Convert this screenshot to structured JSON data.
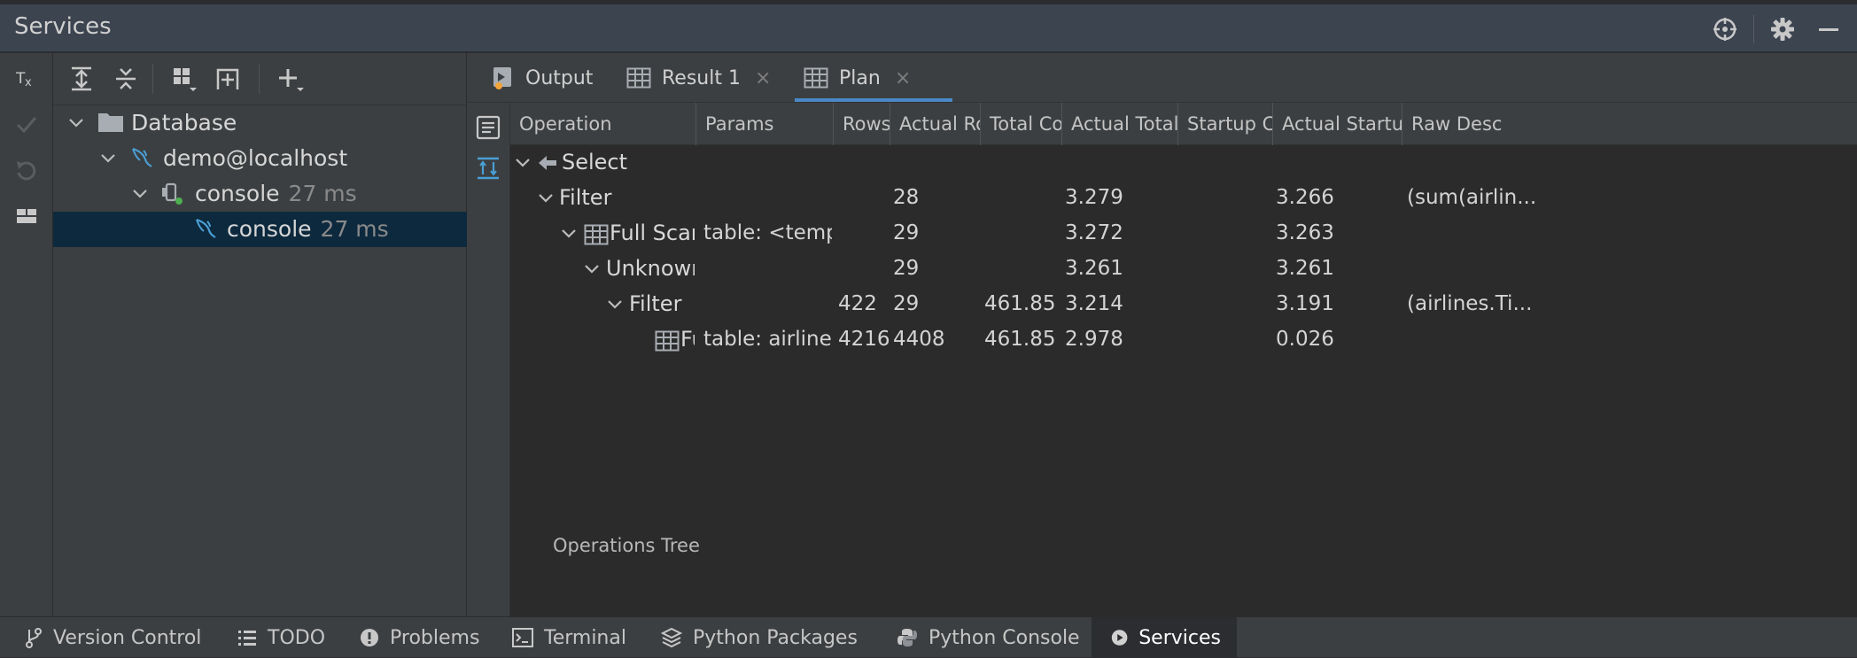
{
  "window": {
    "title": "Services"
  },
  "colors": {
    "accent": "#4a88c7",
    "selection": "#0d293e",
    "mysql_icon": "#4a9fd5",
    "green_dot": "#4caf50",
    "orange_icon": "#f2a33a"
  },
  "left_toolbar": {
    "items": [
      "tx-icon",
      "commit-check-icon",
      "rollback-icon",
      "layout-icon"
    ]
  },
  "tree_toolbar": {
    "items": [
      "expand-all-icon",
      "collapse-all-icon",
      "group-icon",
      "new-session-icon",
      "add-icon"
    ]
  },
  "tree": {
    "database": "Database",
    "host": "demo@localhost",
    "console1": {
      "label": "console",
      "time": "27 ms"
    },
    "console2": {
      "label": "console",
      "time": "27 ms"
    }
  },
  "tabs": [
    {
      "label": "Output",
      "icon": "output-icon",
      "closable": false
    },
    {
      "label": "Result 1",
      "icon": "table-icon",
      "closable": true
    },
    {
      "label": "Plan",
      "icon": "table-icon",
      "closable": true,
      "active": true
    }
  ],
  "tab_close_glyph": "×",
  "plan": {
    "columns": [
      "Operation",
      "Params",
      "Rows",
      "Actual Ro...",
      "Total Cost",
      "Actual Total ...",
      "Startup C...",
      "Actual Startup ...",
      "Raw Desc"
    ],
    "rows": [
      {
        "op": "Select",
        "params": "",
        "rows": "",
        "actual_rows": "",
        "total_cost": "",
        "actual_total": "",
        "startup": "",
        "actual_startup": "",
        "raw": ""
      },
      {
        "op": "Filter",
        "params": "",
        "rows": "",
        "actual_rows": "28",
        "total_cost": "",
        "actual_total": "3.279",
        "startup": "",
        "actual_startup": "3.266",
        "raw": "(sum(airlin..."
      },
      {
        "op": "Full Scan (",
        "params": "table: <temp...",
        "rows": "",
        "actual_rows": "29",
        "total_cost": "",
        "actual_total": "3.272",
        "startup": "",
        "actual_startup": "3.263",
        "raw": ""
      },
      {
        "op": "Unknown (",
        "params": "",
        "rows": "",
        "actual_rows": "29",
        "total_cost": "",
        "actual_total": "3.261",
        "startup": "",
        "actual_startup": "3.261",
        "raw": ""
      },
      {
        "op": "Filter",
        "params": "",
        "rows": "422",
        "actual_rows": "29",
        "total_cost": "461.85",
        "actual_total": "3.214",
        "startup": "",
        "actual_startup": "3.191",
        "raw": "(airlines.Ti..."
      },
      {
        "op": "Fu",
        "params": "table: airlines;",
        "rows": "4216",
        "actual_rows": "4408",
        "total_cost": "461.85",
        "actual_total": "2.978",
        "startup": "",
        "actual_startup": "0.026",
        "raw": ""
      }
    ],
    "footer": "Operations Tree"
  },
  "statusbar": [
    {
      "label": "Version Control",
      "icon": "vcs-icon"
    },
    {
      "label": "TODO",
      "icon": "todo-icon"
    },
    {
      "label": "Problems",
      "icon": "problems-icon"
    },
    {
      "label": "Terminal",
      "icon": "terminal-icon"
    },
    {
      "label": "Python Packages",
      "icon": "packages-icon"
    },
    {
      "label": "Python Console",
      "icon": "python-icon"
    },
    {
      "label": "Services",
      "icon": "services-icon",
      "active": true
    }
  ]
}
